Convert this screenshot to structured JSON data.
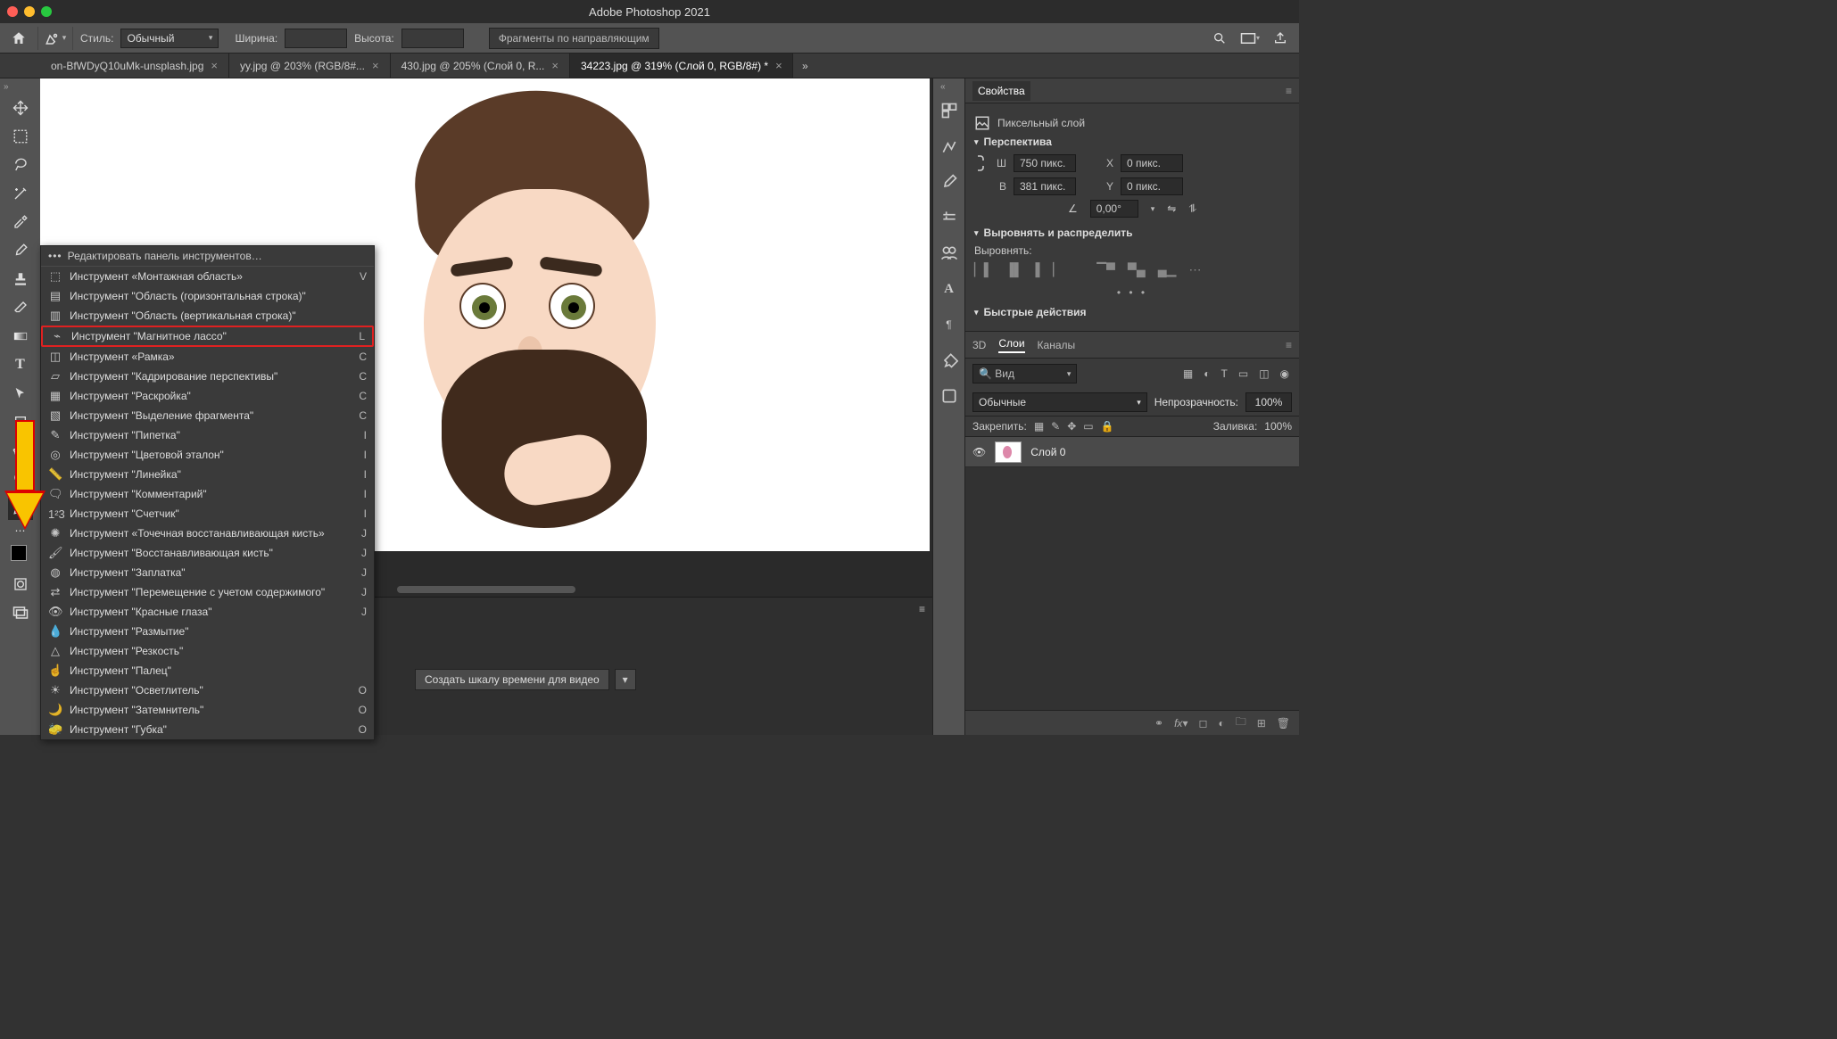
{
  "title": "Adobe Photoshop 2021",
  "optionsBar": {
    "styleLabel": "Стиль:",
    "styleValue": "Обычный",
    "widthLabel": "Ширина:",
    "widthValue": "",
    "heightLabel": "Высота:",
    "heightValue": "",
    "segmentsBtn": "Фрагменты по направляющим"
  },
  "tabs": [
    {
      "label": "on-BfWDyQ10uMk-unsplash.jpg",
      "active": false
    },
    {
      "label": "yy.jpg @ 203% (RGB/8#...",
      "active": false
    },
    {
      "label": "430.jpg @ 205% (Слой 0, R...",
      "active": false
    },
    {
      "label": "34223.jpg @ 319% (Слой 0, RGB/8#) *",
      "active": true
    }
  ],
  "flyout": {
    "header": "Редактировать панель инструментов…",
    "items": [
      {
        "label": "Инструмент «Монтажная область»",
        "key": "V"
      },
      {
        "label": "Инструмент \"Область (горизонтальная строка)\"",
        "key": ""
      },
      {
        "label": "Инструмент \"Область (вертикальная строка)\"",
        "key": ""
      },
      {
        "label": "Инструмент \"Магнитное лассо\"",
        "key": "L",
        "highlight": true
      },
      {
        "label": "Инструмент «Рамка»",
        "key": "C"
      },
      {
        "label": "Инструмент \"Кадрирование перспективы\"",
        "key": "C"
      },
      {
        "label": "Инструмент \"Раскройка\"",
        "key": "C"
      },
      {
        "label": "Инструмент \"Выделение фрагмента\"",
        "key": "C"
      },
      {
        "label": "Инструмент \"Пипетка\"",
        "key": "I"
      },
      {
        "label": "Инструмент \"Цветовой эталон\"",
        "key": "I"
      },
      {
        "label": "Инструмент \"Линейка\"",
        "key": "I"
      },
      {
        "label": "Инструмент \"Комментарий\"",
        "key": "I"
      },
      {
        "label": "Инструмент \"Счетчик\"",
        "key": "I"
      },
      {
        "label": "Инструмент «Точечная восстанавливающая кисть»",
        "key": "J"
      },
      {
        "label": "Инструмент \"Восстанавливающая кисть\"",
        "key": "J"
      },
      {
        "label": "Инструмент \"Заплатка\"",
        "key": "J"
      },
      {
        "label": "Инструмент \"Перемещение с учетом содержимого\"",
        "key": "J"
      },
      {
        "label": "Инструмент \"Красные глаза\"",
        "key": "J"
      },
      {
        "label": "Инструмент \"Размытие\"",
        "key": ""
      },
      {
        "label": "Инструмент \"Резкость\"",
        "key": ""
      },
      {
        "label": "Инструмент \"Палец\"",
        "key": ""
      },
      {
        "label": "Инструмент \"Осветлитель\"",
        "key": "O"
      },
      {
        "label": "Инструмент \"Затемнитель\"",
        "key": "O"
      },
      {
        "label": "Инструмент \"Губка\"",
        "key": "O"
      }
    ]
  },
  "timelineBtn": "Создать шкалу времени для видео",
  "properties": {
    "tab": "Свойства",
    "layerType": "Пиксельный слой",
    "perspective": "Перспектива",
    "W": "750 пикс.",
    "H": "381 пикс.",
    "X": "0 пикс.",
    "Y": "0 пикс.",
    "angle": "0,00°",
    "alignTitle": "Выровнять и распределить",
    "alignLabel": "Выровнять:",
    "quick": "Быстрые действия"
  },
  "layersPanel": {
    "tabs": {
      "t3d": "3D",
      "layers": "Слои",
      "channels": "Каналы"
    },
    "searchPlaceholder": "Вид",
    "blendMode": "Обычные",
    "opacityLabel": "Непрозрачность:",
    "opacityValue": "100%",
    "lockLabel": "Закрепить:",
    "fillLabel": "Заливка:",
    "fillValue": "100%",
    "layer0": "Слой 0"
  }
}
